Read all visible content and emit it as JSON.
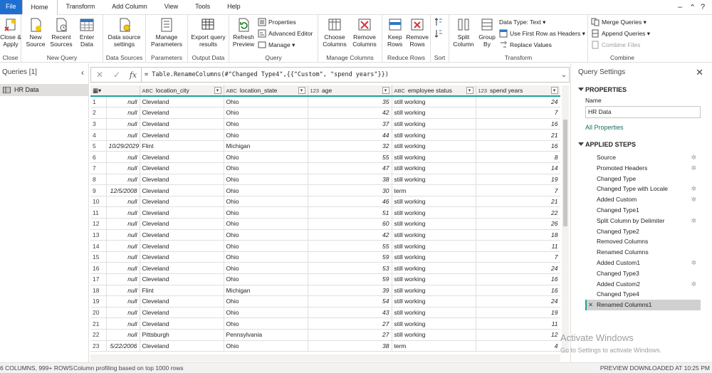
{
  "tabs": [
    "File",
    "Home",
    "Transform",
    "Add Column",
    "View",
    "Tools",
    "Help"
  ],
  "window_controls": {
    "minimize": "–",
    "chevron": "⌃",
    "help": "?"
  },
  "ribbon": {
    "close": {
      "btn": "Close &\nApply",
      "label": "Close"
    },
    "new_query": {
      "new_source": "New\nSource",
      "recent_sources": "Recent\nSources",
      "enter_data": "Enter\nData",
      "label": "New Query"
    },
    "data_sources": {
      "btn": "Data source\nsettings",
      "label": "Data Sources"
    },
    "parameters": {
      "btn": "Manage\nParameters",
      "label": "Parameters"
    },
    "output": {
      "btn": "Export query\nresults",
      "label": "Output Data"
    },
    "query": {
      "refresh": "Refresh\nPreview",
      "properties": "Properties",
      "advanced_editor": "Advanced Editor",
      "manage": "Manage",
      "label": "Query"
    },
    "manage_columns": {
      "choose": "Choose\nColumns",
      "remove": "Remove\nColumns",
      "label": "Manage Columns"
    },
    "reduce_rows": {
      "keep": "Keep\nRows",
      "remove": "Remove\nRows",
      "label": "Reduce Rows"
    },
    "sort": {
      "label": "Sort"
    },
    "transform": {
      "split": "Split\nColumn",
      "group": "Group\nBy",
      "data_type": "Data Type: Text",
      "first_row": "Use First Row as Headers",
      "replace": "Replace Values",
      "label": "Transform"
    },
    "combine": {
      "merge": "Merge Queries",
      "append": "Append Queries",
      "combine_files": "Combine Files",
      "label": "Combine"
    }
  },
  "queries": {
    "header": "Queries [1]",
    "items": [
      "HR Data"
    ]
  },
  "formula": "= Table.RenameColumns(#\"Changed Type4\",{{\"Custom\", \"spend years\"}})",
  "columns": [
    {
      "type": "",
      "name": ""
    },
    {
      "type": "ABC",
      "name": "location_city"
    },
    {
      "type": "ABC",
      "name": "location_state"
    },
    {
      "type": "123",
      "name": "age"
    },
    {
      "type": "ABC",
      "name": "employee status"
    },
    {
      "type": "123",
      "name": "spend years"
    }
  ],
  "rows": [
    [
      "1",
      "null",
      "Cleveland",
      "Ohio",
      "35",
      "still working",
      "24"
    ],
    [
      "2",
      "null",
      "Cleveland",
      "Ohio",
      "42",
      "still working",
      "7"
    ],
    [
      "3",
      "null",
      "Cleveland",
      "Ohio",
      "37",
      "still working",
      "16"
    ],
    [
      "4",
      "null",
      "Cleveland",
      "Ohio",
      "44",
      "still working",
      "21"
    ],
    [
      "5",
      "10/29/2029",
      "Flint",
      "Michigan",
      "32",
      "still working",
      "16"
    ],
    [
      "6",
      "null",
      "Cleveland",
      "Ohio",
      "55",
      "still working",
      "8"
    ],
    [
      "7",
      "null",
      "Cleveland",
      "Ohio",
      "47",
      "still working",
      "14"
    ],
    [
      "8",
      "null",
      "Cleveland",
      "Ohio",
      "38",
      "still working",
      "19"
    ],
    [
      "9",
      "12/5/2008",
      "Cleveland",
      "Ohio",
      "30",
      "term",
      "7"
    ],
    [
      "10",
      "null",
      "Cleveland",
      "Ohio",
      "46",
      "still working",
      "21"
    ],
    [
      "11",
      "null",
      "Cleveland",
      "Ohio",
      "51",
      "still working",
      "22"
    ],
    [
      "12",
      "null",
      "Cleveland",
      "Ohio",
      "60",
      "still working",
      "26"
    ],
    [
      "13",
      "null",
      "Cleveland",
      "Ohio",
      "42",
      "still working",
      "18"
    ],
    [
      "14",
      "null",
      "Cleveland",
      "Ohio",
      "55",
      "still working",
      "11"
    ],
    [
      "15",
      "null",
      "Cleveland",
      "Ohio",
      "59",
      "still working",
      "7"
    ],
    [
      "16",
      "null",
      "Cleveland",
      "Ohio",
      "53",
      "still working",
      "24"
    ],
    [
      "17",
      "null",
      "Cleveland",
      "Ohio",
      "59",
      "still working",
      "16"
    ],
    [
      "18",
      "null",
      "Flint",
      "Michigan",
      "39",
      "still working",
      "16"
    ],
    [
      "19",
      "null",
      "Cleveland",
      "Ohio",
      "54",
      "still working",
      "24"
    ],
    [
      "20",
      "null",
      "Cleveland",
      "Ohio",
      "43",
      "still working",
      "19"
    ],
    [
      "21",
      "null",
      "Cleveland",
      "Ohio",
      "27",
      "still working",
      "11"
    ],
    [
      "22",
      "null",
      "Pittsburgh",
      "Pennsylvania",
      "27",
      "still working",
      "12"
    ],
    [
      "23",
      "5/22/2006",
      "Cleveland",
      "Ohio",
      "38",
      "term",
      "4"
    ]
  ],
  "settings": {
    "title": "Query Settings",
    "properties": "PROPERTIES",
    "name_label": "Name",
    "name_value": "HR Data",
    "all_properties": "All Properties",
    "applied_steps": "APPLIED STEPS",
    "steps": [
      {
        "name": "Source",
        "gear": true
      },
      {
        "name": "Promoted Headers",
        "gear": true
      },
      {
        "name": "Changed Type",
        "gear": false
      },
      {
        "name": "Changed Type with Locale",
        "gear": true
      },
      {
        "name": "Added Custom",
        "gear": true
      },
      {
        "name": "Changed Type1",
        "gear": false
      },
      {
        "name": "Split Column by Delimiter",
        "gear": true
      },
      {
        "name": "Changed Type2",
        "gear": false
      },
      {
        "name": "Removed Columns",
        "gear": false
      },
      {
        "name": "Renamed Columns",
        "gear": false
      },
      {
        "name": "Added Custom1",
        "gear": true
      },
      {
        "name": "Changed Type3",
        "gear": false
      },
      {
        "name": "Added Custom2",
        "gear": true
      },
      {
        "name": "Changed Type4",
        "gear": false
      },
      {
        "name": "Renamed Columns1",
        "gear": false,
        "selected": true
      }
    ]
  },
  "watermark": {
    "line1": "Activate Windows",
    "line2": "Go to Settings to activate Windows."
  },
  "status": {
    "left": "6 COLUMNS, 999+ ROWS",
    "middle": "Column profiling based on top 1000 rows",
    "right": "PREVIEW DOWNLOADED AT 10:25 PM"
  }
}
